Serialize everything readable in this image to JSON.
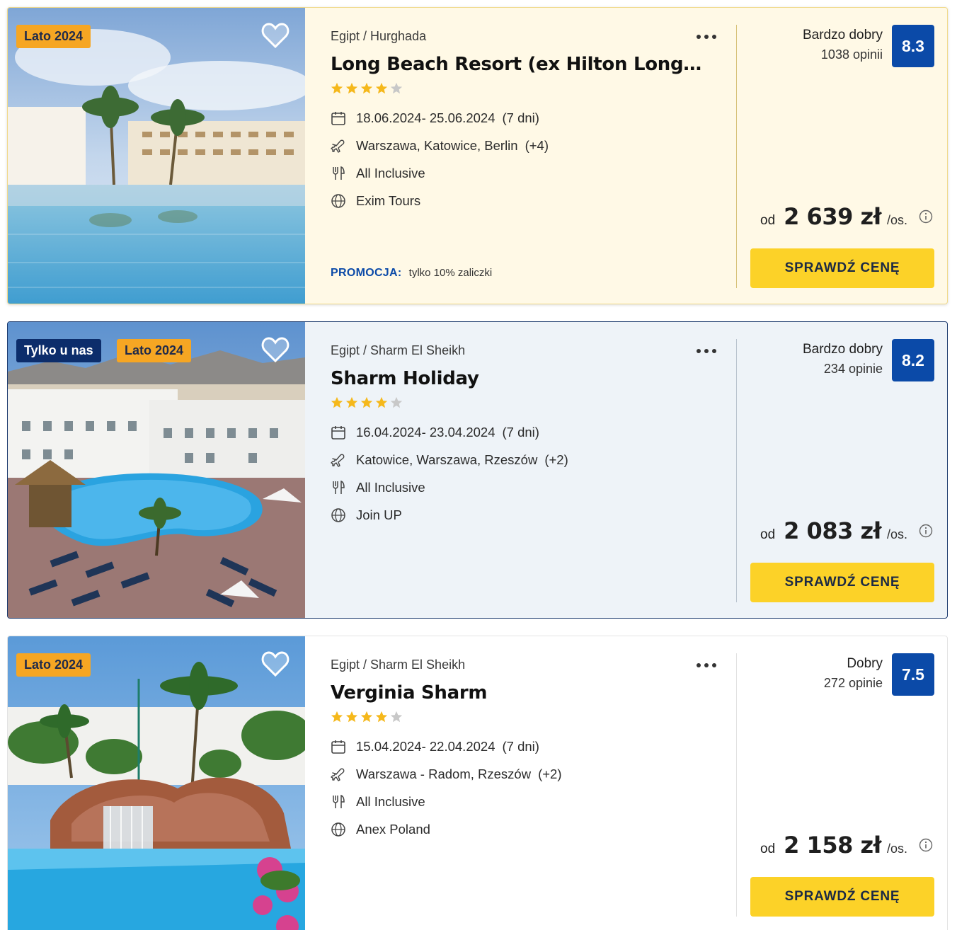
{
  "offers": [
    {
      "badges": [
        {
          "label": "Lato 2024",
          "style": "orange"
        }
      ],
      "location": "Egipt / Hurghada",
      "name": "Long Beach Resort (ex Hilton Long Be...",
      "stars": 4,
      "dates": "18.06.2024- 25.06.2024",
      "duration": "(7 dni)",
      "departure": "Warszawa, Katowice, Berlin",
      "departure_more": "(+4)",
      "board": "All Inclusive",
      "operator": "Exim Tours",
      "promo_label": "PROMOCJA:",
      "promo_text": "tylko 10% zaliczki",
      "rating_label": "Bardzo dobry",
      "reviews": "1038 opinii",
      "score": "8.3",
      "price_prefix": "od",
      "price": "2 639 zł",
      "price_unit": "/os.",
      "button": "SPRAWDŹ CENĘ"
    },
    {
      "badges": [
        {
          "label": "Tylko u nas",
          "style": "navy"
        },
        {
          "label": "Lato 2024",
          "style": "orange"
        }
      ],
      "location": "Egipt / Sharm El Sheikh",
      "name": "Sharm Holiday",
      "stars": 4,
      "dates": "16.04.2024- 23.04.2024",
      "duration": "(7 dni)",
      "departure": "Katowice, Warszawa, Rzeszów",
      "departure_more": "(+2)",
      "board": "All Inclusive",
      "operator": "Join UP",
      "rating_label": "Bardzo dobry",
      "reviews": "234 opinie",
      "score": "8.2",
      "price_prefix": "od",
      "price": "2 083 zł",
      "price_unit": "/os.",
      "button": "SPRAWDŹ CENĘ"
    },
    {
      "badges": [
        {
          "label": "Lato 2024",
          "style": "orange"
        }
      ],
      "location": "Egipt / Sharm El Sheikh",
      "name": "Verginia Sharm",
      "stars": 4,
      "dates": "15.04.2024- 22.04.2024",
      "duration": "(7 dni)",
      "departure": "Warszawa - Radom, Rzeszów",
      "departure_more": "(+2)",
      "board": "All Inclusive",
      "operator": "Anex Poland",
      "rating_label": "Dobry",
      "reviews": "272 opinie",
      "score": "7.5",
      "price_prefix": "od",
      "price": "2 158 zł",
      "price_unit": "/os.",
      "button": "SPRAWDŹ CENĘ"
    }
  ],
  "colors": {
    "badge_orange": "#f6a623",
    "badge_navy": "#0c2d6b",
    "score_blue": "#0b4aa8",
    "button_yellow": "#fcd228",
    "star_yellow": "#f5b81b",
    "star_grey": "#c8c8c8"
  }
}
